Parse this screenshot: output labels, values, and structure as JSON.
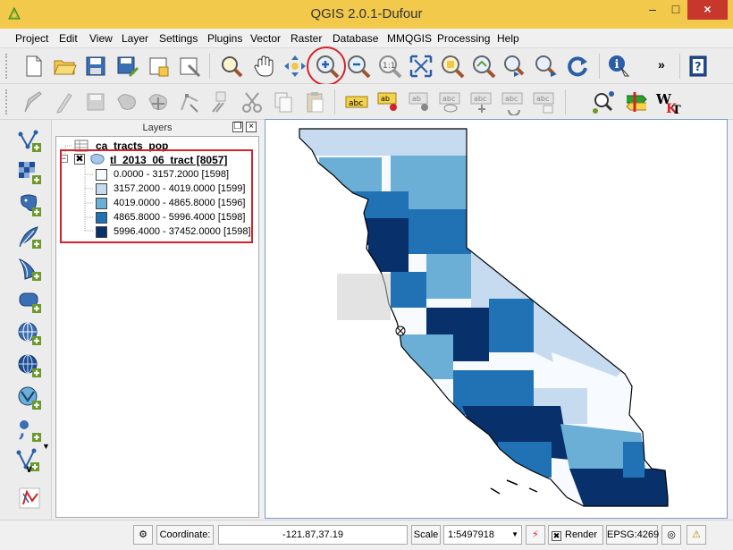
{
  "window": {
    "title": "QGIS 2.0.1-Dufour"
  },
  "menu": [
    "Project",
    "Edit",
    "View",
    "Layer",
    "Settings",
    "Plugins",
    "Vector",
    "Raster",
    "Database",
    "MMQGIS",
    "Processing",
    "Help"
  ],
  "toolbar": {
    "more_label": "»"
  },
  "layers_panel": {
    "title": "Layers",
    "layers": [
      {
        "name": "ca_tracts_pop"
      },
      {
        "name": "tl_2013_06_tract [8057]"
      }
    ],
    "legend": [
      {
        "label": "0.0000 - 3157.2000 [1598]",
        "color": "#f7fbff"
      },
      {
        "label": "3157.2000 - 4019.0000 [1599]",
        "color": "#c6dbef"
      },
      {
        "label": "4019.0000 - 4865.8000 [1596]",
        "color": "#6baed6"
      },
      {
        "label": "4865.8000 - 5996.4000 [1598]",
        "color": "#2171b5"
      },
      {
        "label": "5996.4000 - 37452.0000 [1598]",
        "color": "#08306b"
      }
    ]
  },
  "statusbar": {
    "coordinate_label": "Coordinate:",
    "coordinate_value": "-121.87,37.19",
    "scale_label": "Scale",
    "scale_value": "1:5497918",
    "render_label": "Render",
    "crs_label": "EPSG:4269"
  },
  "colors": {
    "titlebar": "#f2c94a",
    "close": "#c7372c",
    "highlight": "#d2232a"
  }
}
